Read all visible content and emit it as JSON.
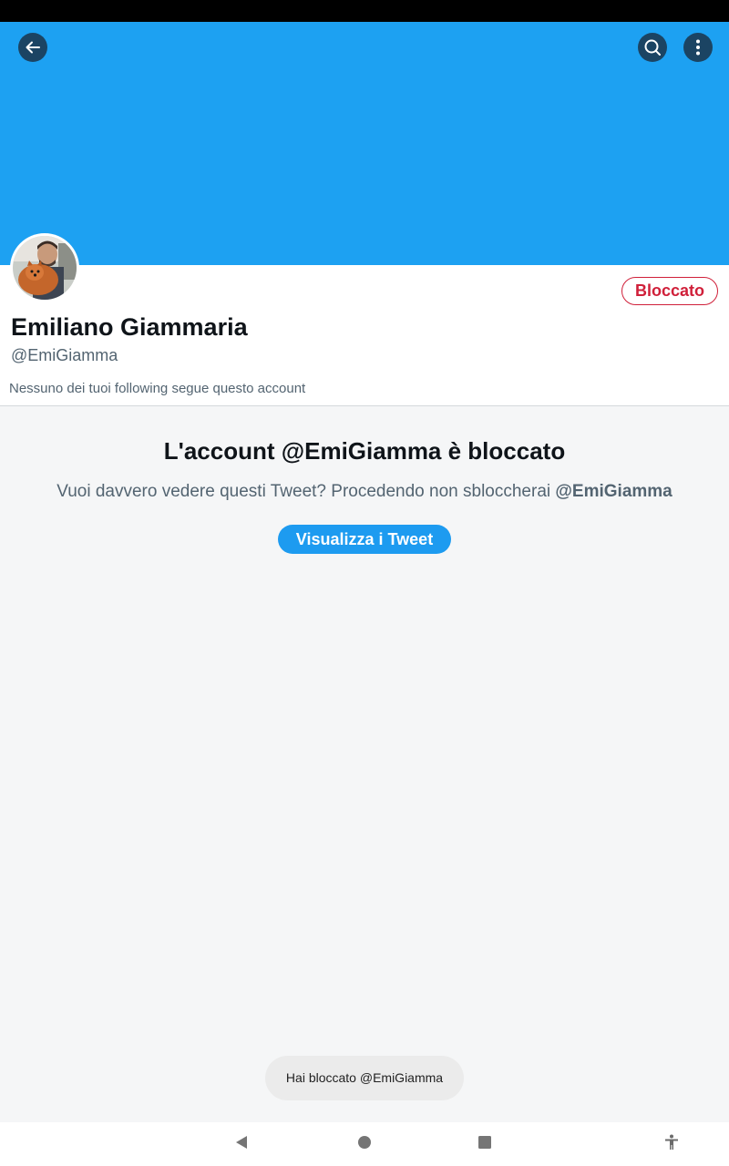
{
  "profile": {
    "display_name": "Emiliano Giammaria",
    "handle": "@EmiGiamma",
    "blocked_button": "Bloccato",
    "followers_note": "Nessuno dei tuoi following segue questo account"
  },
  "blocked_notice": {
    "title": "L'account @EmiGiamma è bloccato",
    "description": "Vuoi davvero vedere questi Tweet? Procedendo non sbloccherai ",
    "description_handle": "@EmiGiamma",
    "view_button": "Visualizza i Tweet"
  },
  "toast": {
    "message": "Hai bloccato @EmiGiamma"
  },
  "icons": {
    "back": "back-arrow-icon",
    "search": "search-icon",
    "more": "more-vertical-icon",
    "nav_back": "nav-back-icon",
    "nav_home": "nav-home-icon",
    "nav_recents": "nav-recents-icon",
    "nav_accessibility": "accessibility-icon"
  },
  "colors": {
    "banner": "#1da1f2",
    "accent": "#1d9bf0",
    "blocked": "#d0203a"
  }
}
